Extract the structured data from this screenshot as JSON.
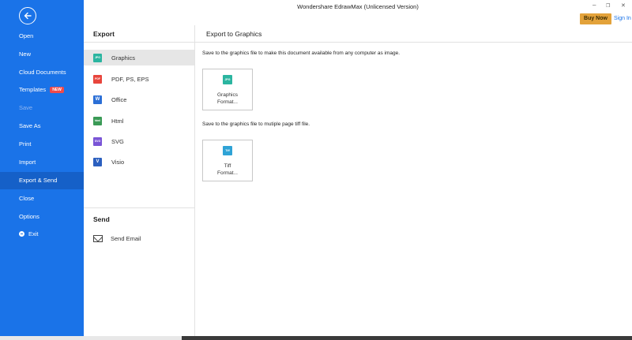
{
  "window": {
    "title": "Wondershare EdrawMax (Unlicensed Version)",
    "buy_now": "Buy Now",
    "sign_in": "Sign In",
    "minimize": "–",
    "restore": "❐",
    "close": "✕"
  },
  "sidebar": {
    "items": [
      {
        "label": "Open"
      },
      {
        "label": "New"
      },
      {
        "label": "Cloud Documents"
      },
      {
        "label": "Templates",
        "badge": "NEW"
      },
      {
        "label": "Save"
      },
      {
        "label": "Save As"
      },
      {
        "label": "Print"
      },
      {
        "label": "Import"
      },
      {
        "label": "Export & Send"
      },
      {
        "label": "Close"
      },
      {
        "label": "Options"
      },
      {
        "label": "Exit"
      }
    ]
  },
  "export_panel": {
    "heading": "Export",
    "items": [
      {
        "label": "Graphics",
        "icon": "JPG",
        "color": "#2bb5a0"
      },
      {
        "label": "PDF, PS, EPS",
        "icon": "PDF",
        "color": "#e8453c"
      },
      {
        "label": "Office",
        "icon": "W",
        "color": "#2b6fd6"
      },
      {
        "label": "Html",
        "icon": "html",
        "color": "#3a9a56"
      },
      {
        "label": "SVG",
        "icon": "SVG",
        "color": "#7a55d6"
      },
      {
        "label": "Visio",
        "icon": "V",
        "color": "#2b5fbf"
      }
    ],
    "send_heading": "Send",
    "send_email": "Send Email"
  },
  "content": {
    "title": "Export to Graphics",
    "desc1": "Save to the graphics file to make this document available from any computer as image.",
    "card1_icon": "JPG",
    "card1_label": "Graphics\nFormat...",
    "desc2": "Save to the graphics file to mutiple page tiff file.",
    "card2_icon": "Tiff",
    "card2_label": "Tiff\nFormat..."
  },
  "colors": {
    "sidebar": "#1a73e8",
    "accent_buy": "#e3a23a",
    "jpg": "#2bb5a0",
    "tiff": "#2fa3d6"
  }
}
